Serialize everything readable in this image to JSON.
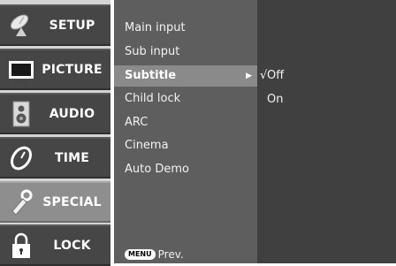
{
  "left_menu": {
    "items": [
      {
        "label": "SETUP",
        "icon": "satellite-dish-icon",
        "active": false
      },
      {
        "label": "PICTURE",
        "icon": "tv-screen-icon",
        "active": false
      },
      {
        "label": "AUDIO",
        "icon": "speaker-icon",
        "active": false
      },
      {
        "label": "TIME",
        "icon": "clock-icon",
        "active": false
      },
      {
        "label": "SPECIAL",
        "icon": "special-tool-icon",
        "active": true
      },
      {
        "label": "LOCK",
        "icon": "padlock-icon",
        "active": false
      }
    ]
  },
  "sub_menu": {
    "items": [
      {
        "label": "Main input",
        "selected": false
      },
      {
        "label": "Sub input",
        "selected": false
      },
      {
        "label": "Subtitle",
        "selected": true
      },
      {
        "label": "Child lock",
        "selected": false
      },
      {
        "label": "ARC",
        "selected": false
      },
      {
        "label": "Cinema",
        "selected": false
      },
      {
        "label": "Auto Demo",
        "selected": false
      }
    ],
    "selected_arrow": "▶"
  },
  "options": {
    "items": [
      {
        "label": "Off",
        "checked": true
      },
      {
        "label": "On",
        "checked": false
      }
    ],
    "check_mark": "√"
  },
  "footer": {
    "menu_key": "MENU",
    "prev_label": "Prev."
  },
  "colors": {
    "left_item_bg": "#464646",
    "left_item_active_bg": "#8e8e8e",
    "submenu_bg": "#5e5e5e",
    "submenu_selected_bg": "#8a8a8a",
    "options_bg": "#404040"
  }
}
